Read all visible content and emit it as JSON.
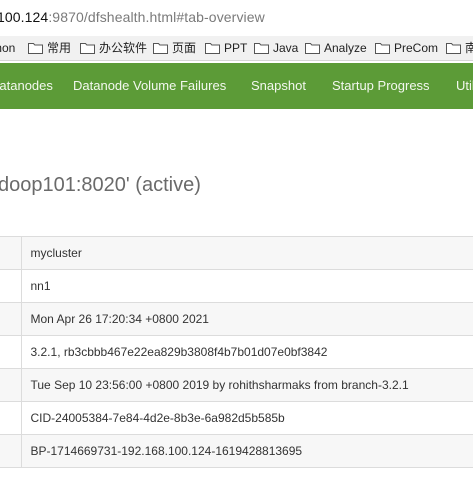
{
  "browser": {
    "url_host": "100.124",
    "url_rest": ":9870/dfshealth.html#tab-overview"
  },
  "bookmarks": [
    {
      "label": "mon",
      "icon": ""
    },
    {
      "label": "常用",
      "icon": "folder-icon"
    },
    {
      "label": "办公软件",
      "icon": "folder-icon"
    },
    {
      "label": "页面",
      "icon": "folder-icon"
    },
    {
      "label": "PPT",
      "icon": "folder-icon"
    },
    {
      "label": "Java",
      "icon": "folder-icon"
    },
    {
      "label": "Analyze",
      "icon": "folder-icon"
    },
    {
      "label": "PreCom",
      "icon": "folder-icon"
    },
    {
      "label": "南",
      "icon": "folder-icon"
    }
  ],
  "navbar": {
    "items": [
      "Datanodes",
      "Datanode Volume Failures",
      "Snapshot",
      "Startup Progress",
      "Utilities"
    ],
    "color": "#5c9b37"
  },
  "heading": "doop101:8020' (active)",
  "overview": {
    "rows": [
      {
        "value": "mycluster"
      },
      {
        "value": "nn1"
      },
      {
        "value": "Mon Apr 26 17:20:34 +0800 2021"
      },
      {
        "value": "3.2.1, rb3cbbb467e22ea829b3808f4b7b01d07e0bf3842"
      },
      {
        "value": "Tue Sep 10 23:56:00 +0800 2019 by rohithsharmaks from branch-3.2.1"
      },
      {
        "value": "CID-24005384-7e84-4d2e-8b3e-6a982d5b585b"
      },
      {
        "value": "BP-1714669731-192.168.100.124-1619428813695"
      }
    ]
  }
}
